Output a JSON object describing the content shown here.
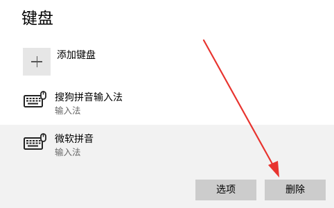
{
  "page": {
    "title": "键盘"
  },
  "add_keyboard": {
    "label": "添加键盘",
    "icon": "plus-icon"
  },
  "keyboards": [
    {
      "name": "搜狗拼音输入法",
      "subtitle": "输入法",
      "icon": "keyboard-icon",
      "selected": false
    },
    {
      "name": "微软拼音",
      "subtitle": "输入法",
      "icon": "keyboard-icon",
      "selected": true
    }
  ],
  "actions": {
    "options_label": "选项",
    "delete_label": "删除"
  },
  "colors": {
    "selected_background": "#f2f2f2",
    "button_background": "#cccccc",
    "add_tile_background": "#e6e6e6",
    "annotation_arrow": "#e8342f"
  }
}
